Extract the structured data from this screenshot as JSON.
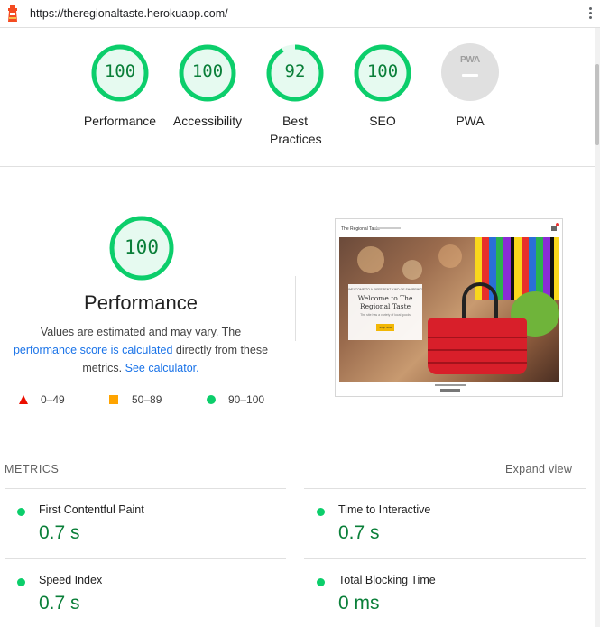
{
  "url_bar": {
    "url": "https://theregionaltaste.herokuapp.com/"
  },
  "colors": {
    "pass_green": "#0cce6b",
    "pass_text": "#0a7f39",
    "average_orange": "#ffa400",
    "fail_red": "#eb0f00",
    "link_blue": "#1a73e8"
  },
  "scores": [
    {
      "label": "Performance",
      "score": "100",
      "fraction": 1.0
    },
    {
      "label": "Accessibility",
      "score": "100",
      "fraction": 1.0
    },
    {
      "label": "Best Practices",
      "score": "92",
      "fraction": 0.92
    },
    {
      "label": "SEO",
      "score": "100",
      "fraction": 1.0
    },
    {
      "label": "PWA",
      "badge_text": "PWA",
      "icon": "pwa-badge-icon"
    }
  ],
  "performance": {
    "score": "100",
    "title": "Performance",
    "desc_prefix": "Values are estimated and may vary. The ",
    "desc_link1": "performance score is calculated",
    "desc_middle": " directly from these metrics. ",
    "desc_link2": "See calculator."
  },
  "legend": [
    {
      "icon": "triangle-icon",
      "range": "0–49"
    },
    {
      "icon": "square-icon",
      "range": "50–89"
    },
    {
      "icon": "circle-icon",
      "range": "90–100"
    }
  ],
  "thumbnail": {
    "brand": "The Regional Taste",
    "small_text": "WELCOME TO A DIFFERENT KIND OF SHOPPING",
    "heading": "Welcome to The Regional Taste",
    "sub_text": "The site has a variety of local goods",
    "button": "Shop Now"
  },
  "metrics": {
    "heading": "METRICS",
    "expand_label": "Expand view",
    "items": [
      {
        "name": "First Contentful Paint",
        "value": "0.7 s"
      },
      {
        "name": "Time to Interactive",
        "value": "0.7 s"
      },
      {
        "name": "Speed Index",
        "value": "0.7 s"
      },
      {
        "name": "Total Blocking Time",
        "value": "0 ms"
      }
    ]
  }
}
